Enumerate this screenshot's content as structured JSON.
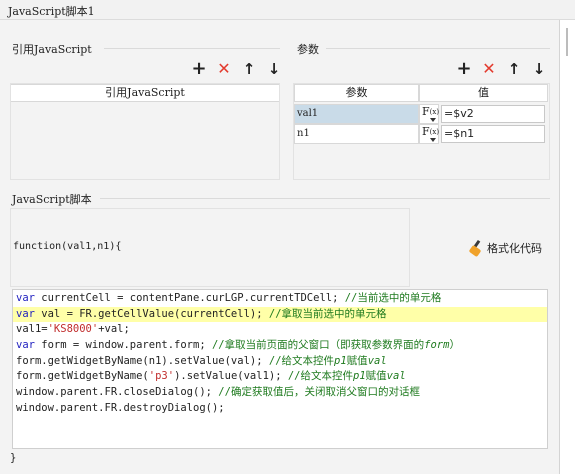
{
  "window": {
    "title": "JavaScript脚本1"
  },
  "references": {
    "section_label": "引用JavaScript",
    "toolbar": {
      "add": "+",
      "delete": "✕",
      "up": "↑",
      "down": "↓"
    },
    "column_header": "引用JavaScript"
  },
  "parameters": {
    "section_label": "参数",
    "toolbar": {
      "add": "+",
      "delete": "✕",
      "up": "↑",
      "down": "↓"
    },
    "columns": [
      "参数",
      "值"
    ],
    "rows": [
      {
        "name": "val1",
        "fx": "F",
        "fx_sub": "(x)",
        "value": "=$v2",
        "selected": true
      },
      {
        "name": "n1",
        "fx": "F",
        "fx_sub": "(x)",
        "value": "=$n1",
        "selected": false
      }
    ]
  },
  "script": {
    "section_label": "JavaScript脚本",
    "signature": "function(val1,n1){",
    "format_button": "格式化代码",
    "closing_brace": "}",
    "highlighted_line": 2,
    "lines": [
      "var currentCell = contentPane.curLGP.currentTDCell; //当前选中的单元格",
      "var val = FR.getCellValue(currentCell); //拿取当前选中的单元格",
      "val1='KS8000'+val;",
      "var form = window.parent.form; //拿取当前页面的父窗口（即获取参数界面的form）",
      "form.getWidgetByName(n1).setValue(val); //给文本控件p1赋值val",
      "form.getWidgetByName('p3').setValue(val1); //给文本控件p1赋值val",
      "window.parent.FR.closeDialog(); //确定获取值后，关闭取消父窗口的对话框",
      "window.parent.FR.destroyDialog();"
    ]
  },
  "colors": {
    "keyword": "#1f1fbf",
    "string": "#c12d2d",
    "comment": "#1e7a1e",
    "highlight": "#ffffa8",
    "selected_row": "#c9dbe8",
    "delete_icon": "#e33b2e"
  }
}
